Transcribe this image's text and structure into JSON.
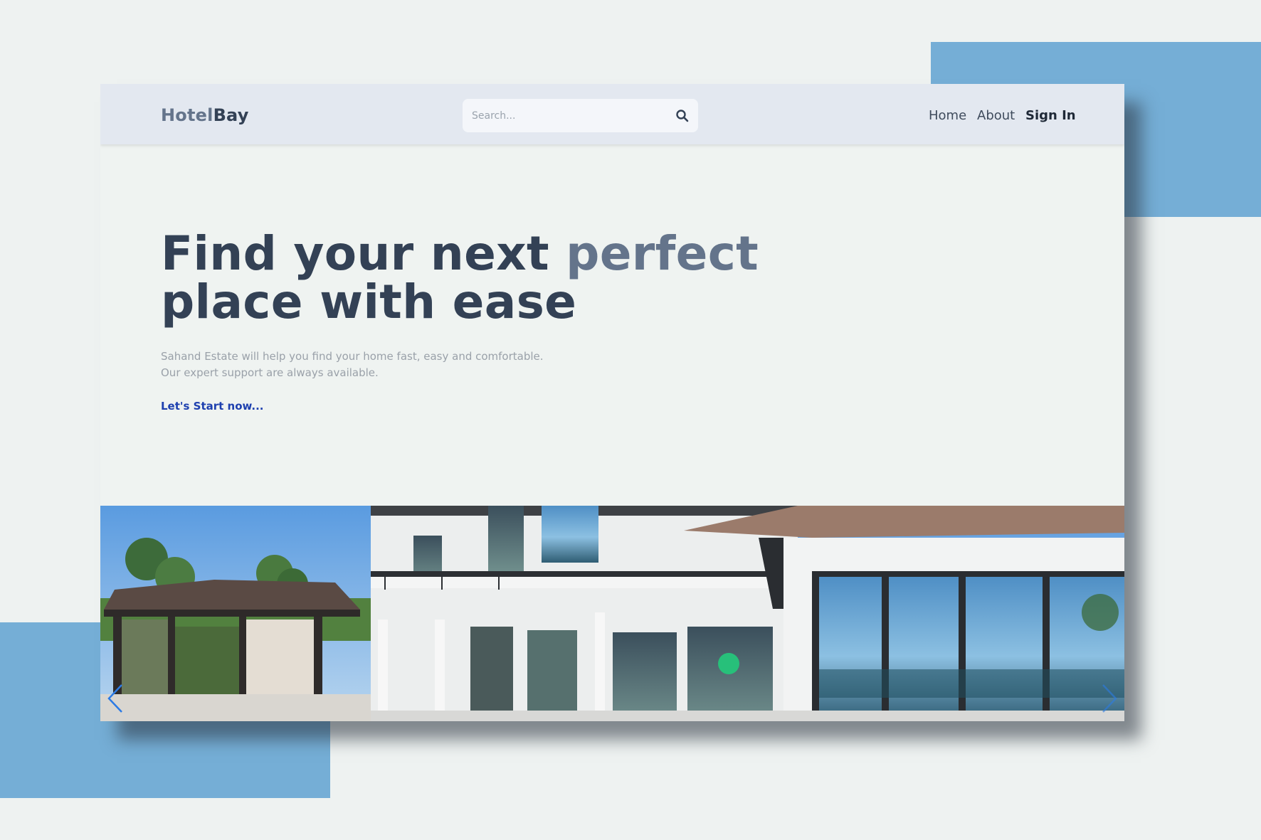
{
  "nav": {
    "logo_part1": "Hotel",
    "logo_part2": "Bay",
    "search_placeholder": "Search...",
    "links": [
      "Home",
      "About",
      "Sign In"
    ]
  },
  "hero": {
    "title_main": "Find your next ",
    "title_accent": "perfect",
    "title_line2": "place with ease",
    "subtitle_line1": "Sahand Estate will help you find your home fast, easy and comfortable.",
    "subtitle_line2": "Our expert support are always available.",
    "cta": "Let's Start now..."
  },
  "slider": {
    "image": "modern-house-photo",
    "prev_icon": "chevron-left-icon",
    "next_icon": "chevron-right-icon"
  },
  "colors": {
    "page_bg": "#eef2f1",
    "decor_blue": "#75aed6",
    "nav_bg": "#e3e8f0",
    "title": "#334155",
    "title_accent": "#64748b",
    "cta": "#1e40af"
  }
}
